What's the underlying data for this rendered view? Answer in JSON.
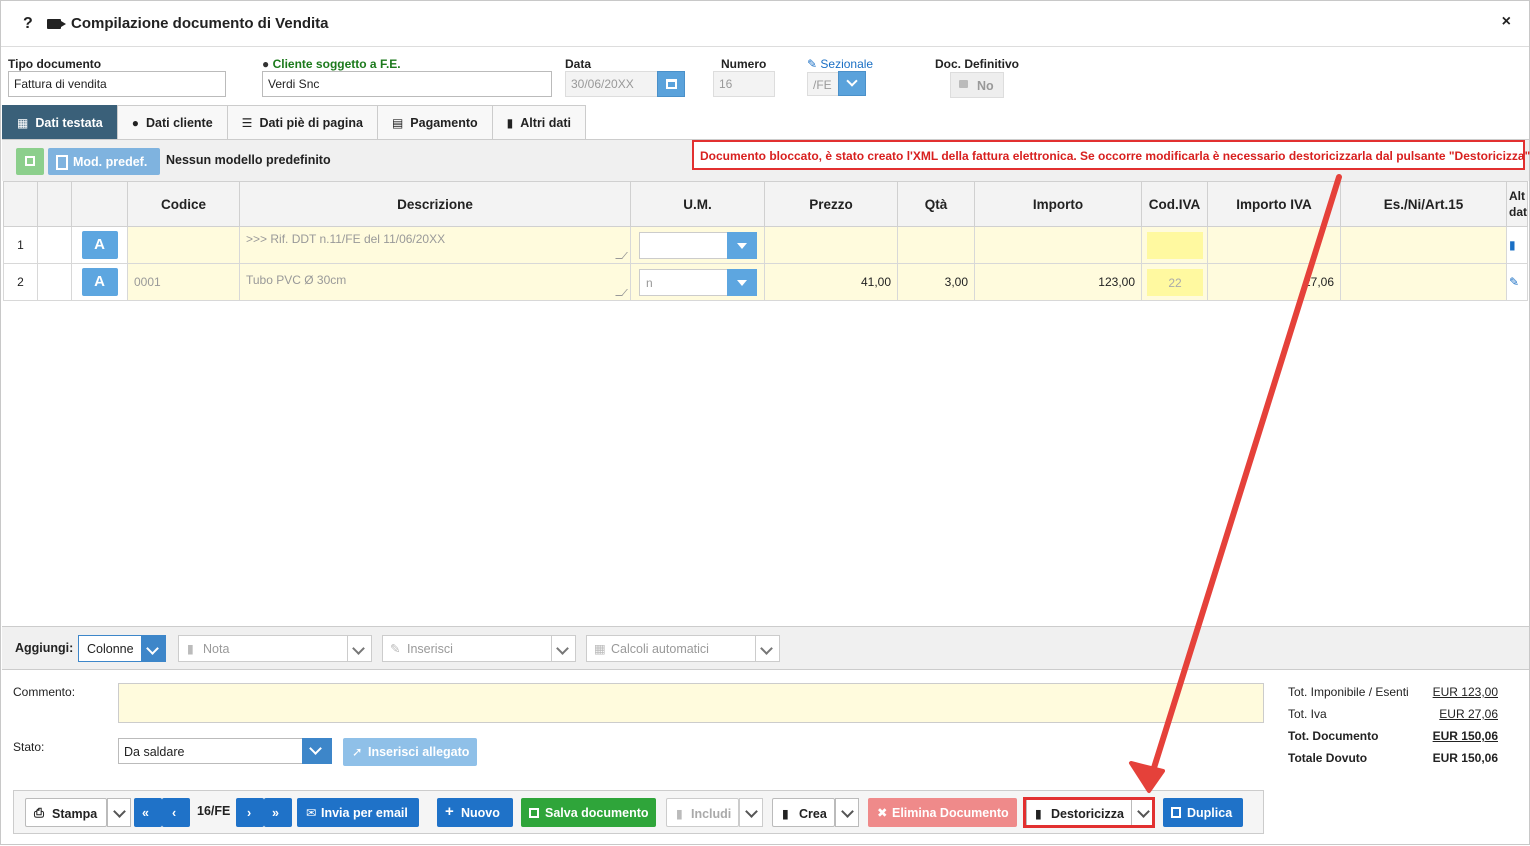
{
  "window": {
    "help": "?",
    "title": "Compilazione documento di Vendita",
    "close": "×"
  },
  "header": {
    "tipo_label": "Tipo documento",
    "tipo_value": "Fattura di vendita",
    "cliente_label": "Cliente soggetto a F.E.",
    "cliente_value": "Verdi Snc",
    "data_label": "Data",
    "data_value": "30/06/20XX",
    "numero_label": "Numero",
    "numero_value": "16",
    "sezionale_label": "Sezionale",
    "sezionale_value": "/FE",
    "definitivo_label": "Doc. Definitivo",
    "definitivo_value": "No"
  },
  "tabs": [
    "Dati testata",
    "Dati cliente",
    "Dati piè di pagina",
    "Pagamento",
    "Altri dati"
  ],
  "toolbar": {
    "mod_label": "Mod. predef.",
    "nessun": "Nessun modello predefinito",
    "alert": "Documento bloccato, è stato creato l'XML della fattura elettronica. Se occorre modificarla è necessario destoricizzarla dal pulsante \"Destoricizza\""
  },
  "grid": {
    "columns": [
      "",
      "",
      "",
      "Codice",
      "Descrizione",
      "U.M.",
      "Prezzo",
      "Qtà",
      "Importo",
      "Cod.IVA",
      "Importo IVA",
      "Es./Ni/Art.15",
      "Alt dat"
    ],
    "rows": [
      {
        "n": "1",
        "badge": "A",
        "codice": "",
        "descrizione": ">>> Rif. DDT n.11/FE del 11/06/20XX",
        "um": "",
        "prezzo": "",
        "qta": "",
        "importo": "",
        "codiva": "",
        "importo_iva": "",
        "es": ""
      },
      {
        "n": "2",
        "badge": "A",
        "codice": "0001",
        "descrizione": "Tubo PVC Ø 30cm",
        "um": "n",
        "prezzo": "41,00",
        "qta": "3,00",
        "importo": "123,00",
        "codiva": "22",
        "importo_iva": "27,06",
        "es": ""
      }
    ]
  },
  "aggiungi": {
    "label": "Aggiungi:",
    "colonne": "Colonne",
    "nota": "Nota",
    "inserisci": "Inserisci",
    "calcoli": "Calcoli automatici"
  },
  "footer": {
    "commento_label": "Commento:",
    "stato_label": "Stato:",
    "stato_value": "Da saldare",
    "allegato": "Inserisci allegato",
    "totals": [
      {
        "label": "Tot. Imponibile / Esenti",
        "value": "EUR 123,00",
        "bold": false
      },
      {
        "label": "Tot. Iva",
        "value": "EUR 27,06",
        "bold": false
      },
      {
        "label": "Tot. Documento",
        "value": "EUR 150,06",
        "bold": true
      },
      {
        "label": "Totale Dovuto",
        "value": "EUR 150,06",
        "bold": true
      }
    ]
  },
  "buttons": {
    "stampa": "Stampa",
    "first": "«",
    "prev": "‹",
    "page": "16/FE",
    "next": "›",
    "last": "»",
    "email": "Invia per email",
    "nuovo": "Nuovo",
    "salva": "Salva documento",
    "includi": "Includi",
    "crea": "Crea",
    "elimina": "Elimina Documento",
    "destoricizza": "Destoricizza",
    "duplica": "Duplica"
  },
  "colors": {
    "accent": "#1f72c8",
    "alert": "#e23030",
    "tab_active": "#3a6079",
    "cell_yellow": "#fffbdd"
  }
}
